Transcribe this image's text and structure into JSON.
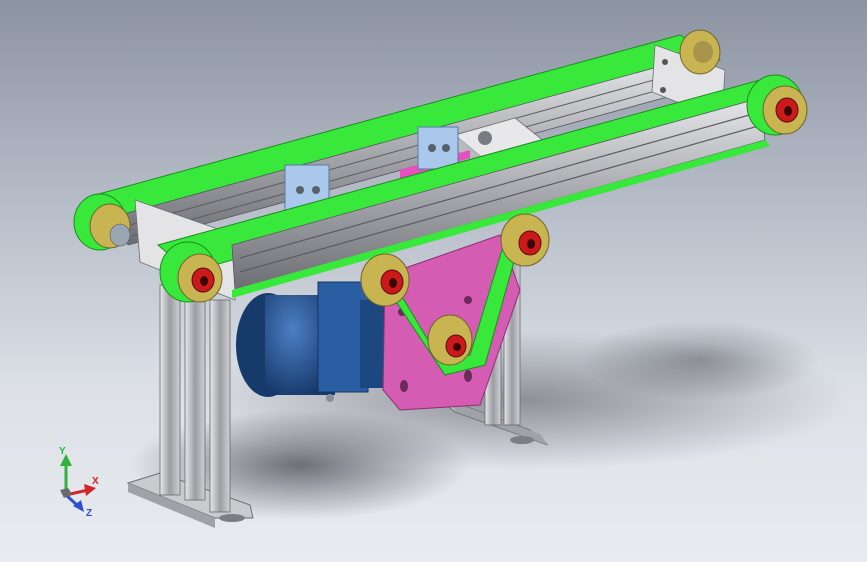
{
  "viewport": {
    "background_top": "#8c93a2",
    "background_bottom": "#e8ebef"
  },
  "model": {
    "name": "belt-conveyor-assembly",
    "colors": {
      "belt": "#38e83a",
      "belt_dark": "#1fae22",
      "frame_light": "#d9dadd",
      "frame_dark": "#6f6f74",
      "pulley_ring": "#c8b450",
      "pulley_hub": "#cc1a1a",
      "side_plate": "#d45cb3",
      "motor_blue": "#1f4f8f",
      "bracket_blue": "#a9c8ec",
      "end_plate": "#e6e6e6"
    }
  },
  "triad": {
    "y_label": "Y",
    "x_label": "X",
    "z_label": "Z",
    "y_color": "#2fb33b",
    "x_color": "#d2262b",
    "z_color": "#2e4fd0"
  }
}
